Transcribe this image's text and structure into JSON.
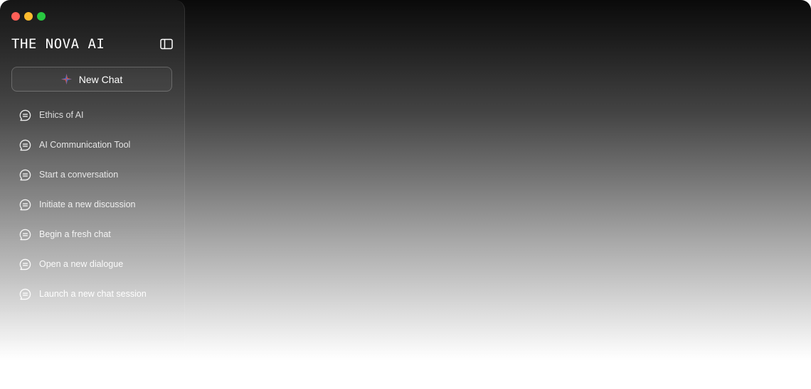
{
  "window": {
    "controls": [
      "close",
      "minimize",
      "maximize"
    ]
  },
  "sidebar": {
    "brand": "THE NOVA AI",
    "toggle_icon": "sidebar-toggle-icon",
    "new_chat_label": "New Chat",
    "new_chat_icon": "sparkle-icon",
    "history": [
      {
        "label": "Ethics of AI",
        "icon": "chat-bubble-icon"
      },
      {
        "label": "AI Communication Tool",
        "icon": "chat-bubble-icon"
      },
      {
        "label": "Start a conversation",
        "icon": "chat-bubble-icon"
      },
      {
        "label": "Initiate a new discussion",
        "icon": "chat-bubble-icon"
      },
      {
        "label": "Begin a fresh chat",
        "icon": "chat-bubble-icon"
      },
      {
        "label": "Open a new dialogue",
        "icon": "chat-bubble-icon"
      },
      {
        "label": "Launch a new chat session",
        "icon": "chat-bubble-icon"
      }
    ]
  },
  "colors": {
    "close": "#ff5f57",
    "minimize": "#febc2e",
    "maximize": "#28c840",
    "spark_red": "#e0533d",
    "spark_blue": "#3b6fd8"
  }
}
